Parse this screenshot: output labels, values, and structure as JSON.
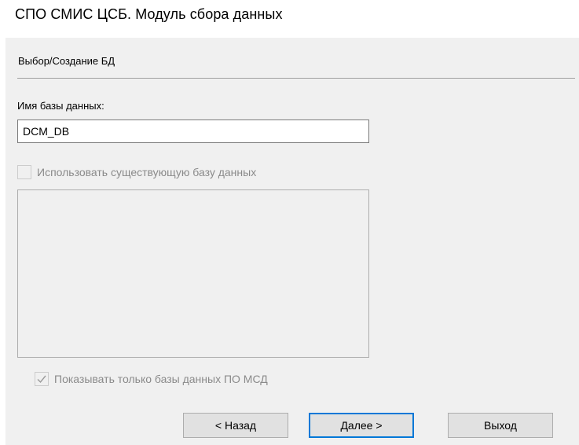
{
  "window": {
    "title": "СПО СМИС ЦСБ. Модуль сбора данных"
  },
  "section": {
    "title": "Выбор/Создание БД"
  },
  "db_name": {
    "label": "Имя базы данных:",
    "value": "DCM_DB"
  },
  "use_existing": {
    "label": "Использовать существующую базу данных",
    "checked": false,
    "enabled": false
  },
  "show_only": {
    "label": "Показывать только базы данных ПО МСД",
    "checked": true,
    "enabled": false
  },
  "buttons": {
    "back": "< Назад",
    "next": "Далее >",
    "exit": "Выход"
  },
  "colors": {
    "accent": "#0078d7",
    "panel": "#f0f0f0",
    "disabled_text": "#8a8a8a"
  },
  "icons": {
    "check": "check-icon"
  }
}
